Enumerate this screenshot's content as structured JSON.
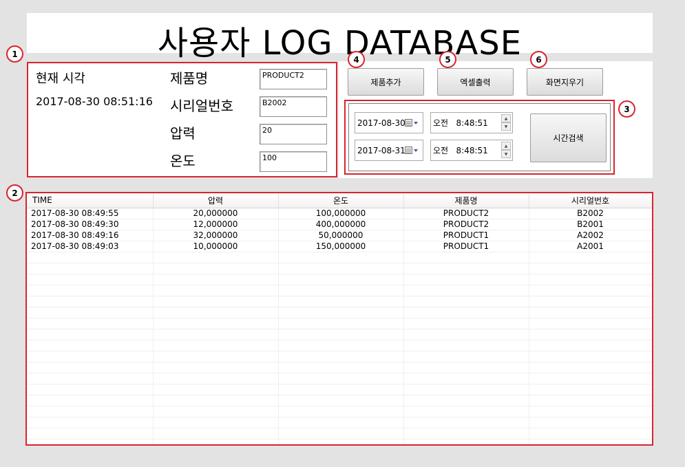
{
  "header": {
    "title": "사용자 LOG DATABASE"
  },
  "info_panel": {
    "clock_label": "현재 시각",
    "clock_value": "2017-08-30 08:51:16",
    "fields": [
      {
        "label": "제품명",
        "value": "PRODUCT2"
      },
      {
        "label": "시리얼번호",
        "value": "B2002"
      },
      {
        "label": "압력",
        "value": "20"
      },
      {
        "label": "온도",
        "value": "100"
      }
    ]
  },
  "actions": {
    "add_product": "제품추가",
    "export_excel": "엑셀출력",
    "clear_screen": "화면지우기"
  },
  "search": {
    "start_date": "2017-08-30",
    "end_date": "2017-08-31",
    "start_time": "오전   8:48:51",
    "end_time": "오전   8:48:51",
    "button": "시간검색"
  },
  "markers": [
    "1",
    "2",
    "3",
    "4",
    "5",
    "6"
  ],
  "table": {
    "columns": [
      "TIME",
      "압력",
      "온도",
      "제품명",
      "시리얼번호"
    ],
    "rows": [
      [
        "2017-08-30 08:49:55",
        "20,000000",
        "100,000000",
        "PRODUCT2",
        "B2002"
      ],
      [
        "2017-08-30 08:49:30",
        "12,000000",
        "400,000000",
        "PRODUCT2",
        "B2001"
      ],
      [
        "2017-08-30 08:49:16",
        "32,000000",
        "50,000000",
        "PRODUCT1",
        "A2002"
      ],
      [
        "2017-08-30 08:49:03",
        "10,000000",
        "150,000000",
        "PRODUCT1",
        "A2001"
      ]
    ]
  },
  "colors": {
    "annotation": "#d9232e",
    "background": "#e3e3e3"
  },
  "icons": [
    "calendar-dropdown-icon",
    "spin-up-icon",
    "spin-down-icon"
  ]
}
